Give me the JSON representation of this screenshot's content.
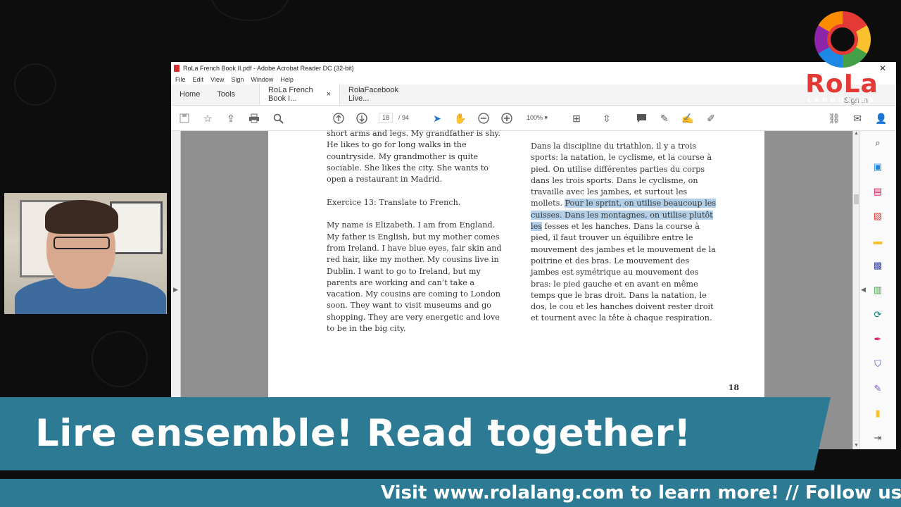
{
  "window": {
    "title": "RoLa French Book II.pdf - Adobe Acrobat Reader DC (32-bit)",
    "close_glyph": "✕"
  },
  "menu": [
    "File",
    "Edit",
    "View",
    "Sign",
    "Window",
    "Help"
  ],
  "tabs": {
    "home": "Home",
    "tools": "Tools",
    "doc1": "RoLa French Book I...",
    "doc1_close": "×",
    "doc2": "RolaFacebook Live...",
    "signin": "Sign In"
  },
  "toolbar": {
    "page_current": "18",
    "page_total": "/ 94",
    "zoom": "100%"
  },
  "page": {
    "left_paragraphs": [
      "short arms and legs. My grandfather is shy. He likes to go for long walks in the countryside. My grandmother is quite sociable. She likes the city. She wants to open a restaurant in Madrid.",
      "Exercice 13: Translate to French.",
      "My name is Elizabeth. I am from England. My father is English, but my mother comes from Ireland. I have blue eyes, fair skin and red hair, like my mother. My cousins live in Dublin. I want to go to Ireland, but my parents are working and can’t take a vacation. My cousins are coming to London soon. They want to visit museums and go shopping. They are very energetic and love to be in the big city."
    ],
    "right_before": "Dans la discipline du triathlon, il y a trois sports: la natation, le cyclisme, et la course à pied. On utilise différentes parties du corps dans les trois sports. Dans le cyclisme, on travaille avec les jambes, et surtout les mollets. ",
    "right_highlight": "Pour le sprint, on utilise beaucoup les cuisses. Dans les montagnes, on utilise plutôt les",
    "right_after": " fesses et les hanches. Dans la course à pied, il faut trouver un équilibre entre le mouvement des jambes et le mouvement de la poitrine et des bras. Le mouvement des jambes est symétrique au mouvement des bras: le pied gauche et en avant en même temps que le bras droit. Dans la natation, le dos, le cou et les hanches doivent rester droit et tournent avec la tête à chaque respiration.",
    "number": "18"
  },
  "logo": {
    "word": "RoLa",
    "sub": "LANGUAGES"
  },
  "banner": {
    "text": "Lire ensemble! Read together!"
  },
  "ticker": {
    "text": "Visit www.rolalang.com to learn more! // Follow us on"
  },
  "colors": {
    "banner": "#2c7a94",
    "highlight": "#b3cfe8",
    "logo_red": "#e53935"
  },
  "icons": {
    "toolbar": [
      "save-icon",
      "star-icon",
      "upload-icon",
      "print-icon",
      "search-icon",
      "prev-page-icon",
      "next-page-icon",
      "select-cursor-icon",
      "hand-icon",
      "zoom-out-icon",
      "zoom-in-icon",
      "fit-page-icon",
      "scroll-icon",
      "comment-icon",
      "highlight-icon",
      "sign-icon",
      "edit-icon",
      "link-icon",
      "mail-icon",
      "share-user-icon"
    ],
    "right_panel": [
      "zoom-icon",
      "export-pdf-icon",
      "organize-icon",
      "create-pdf-icon",
      "comment-icon",
      "send-icon",
      "compress-icon",
      "convert-icon",
      "fill-sign-icon",
      "protect-icon",
      "edit-icon",
      "more-tools-icon"
    ]
  }
}
